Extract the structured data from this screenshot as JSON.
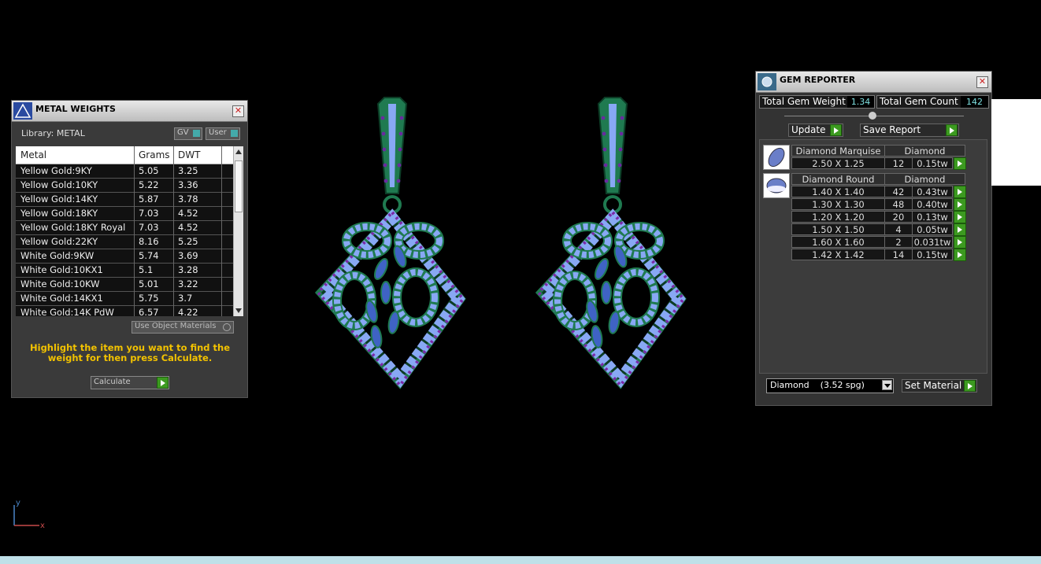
{
  "metal_panel": {
    "title": "METAL WEIGHTS",
    "library_label": "Library: METAL",
    "toggle_gv": "GV",
    "toggle_user": "User",
    "columns": [
      "Metal",
      "Grams",
      "DWT"
    ],
    "rows": [
      {
        "metal": "Yellow Gold:9KY",
        "grams": "5.05",
        "dwt": "3.25"
      },
      {
        "metal": "Yellow Gold:10KY",
        "grams": "5.22",
        "dwt": "3.36"
      },
      {
        "metal": "Yellow Gold:14KY",
        "grams": "5.87",
        "dwt": "3.78"
      },
      {
        "metal": "Yellow Gold:18KY",
        "grams": "7.03",
        "dwt": "4.52"
      },
      {
        "metal": "Yellow Gold:18KY Royal",
        "grams": "7.03",
        "dwt": "4.52"
      },
      {
        "metal": "Yellow Gold:22KY",
        "grams": "8.16",
        "dwt": "5.25"
      },
      {
        "metal": "White Gold:9KW",
        "grams": "5.74",
        "dwt": "3.69"
      },
      {
        "metal": "White Gold:10KX1",
        "grams": "5.1",
        "dwt": "3.28"
      },
      {
        "metal": "White Gold:10KW",
        "grams": "5.01",
        "dwt": "3.22"
      },
      {
        "metal": "White Gold:14KX1",
        "grams": "5.75",
        "dwt": "3.7"
      },
      {
        "metal": "White Gold:14K PdW",
        "grams": "6.57",
        "dwt": "4.22"
      }
    ],
    "use_object_materials": "Use Object Materials",
    "instruction": "Highlight the item you want to find the weight for then press Calculate.",
    "calculate_label": "Calculate"
  },
  "gem_panel": {
    "title": "GEM REPORTER",
    "total_weight_label": "Total Gem Weight",
    "total_weight_value": "1.34",
    "total_count_label": "Total Gem Count",
    "total_count_value": "142",
    "update_label": "Update",
    "save_report_label": "Save Report",
    "groups": [
      {
        "shape": "Diamond Marquise",
        "material": "Diamond",
        "rows": [
          {
            "size": "2.50 X 1.25",
            "count": "12",
            "weight": "0.15tw"
          }
        ]
      },
      {
        "shape": "Diamond Round",
        "material": "Diamond",
        "rows": [
          {
            "size": "1.40 X 1.40",
            "count": "42",
            "weight": "0.43tw"
          },
          {
            "size": "1.30 X 1.30",
            "count": "48",
            "weight": "0.40tw"
          },
          {
            "size": "1.20 X 1.20",
            "count": "20",
            "weight": "0.13tw"
          },
          {
            "size": "1.50 X 1.50",
            "count": "4",
            "weight": "0.05tw"
          },
          {
            "size": "1.60 X 1.60",
            "count": "2",
            "weight": "0.031tw"
          },
          {
            "size": "1.42 X 1.42",
            "count": "14",
            "weight": "0.15tw"
          }
        ]
      }
    ],
    "material_select": "Diamond    (3.52 spg)",
    "set_material_label": "Set Material"
  },
  "axis": {
    "y": "y",
    "x": "x"
  },
  "colors": {
    "metal": "#1f7a50",
    "stone": "#88a8f4",
    "accent_stone": "#7a2aa8",
    "marquise": "#3f63c4",
    "background": "#000000"
  }
}
